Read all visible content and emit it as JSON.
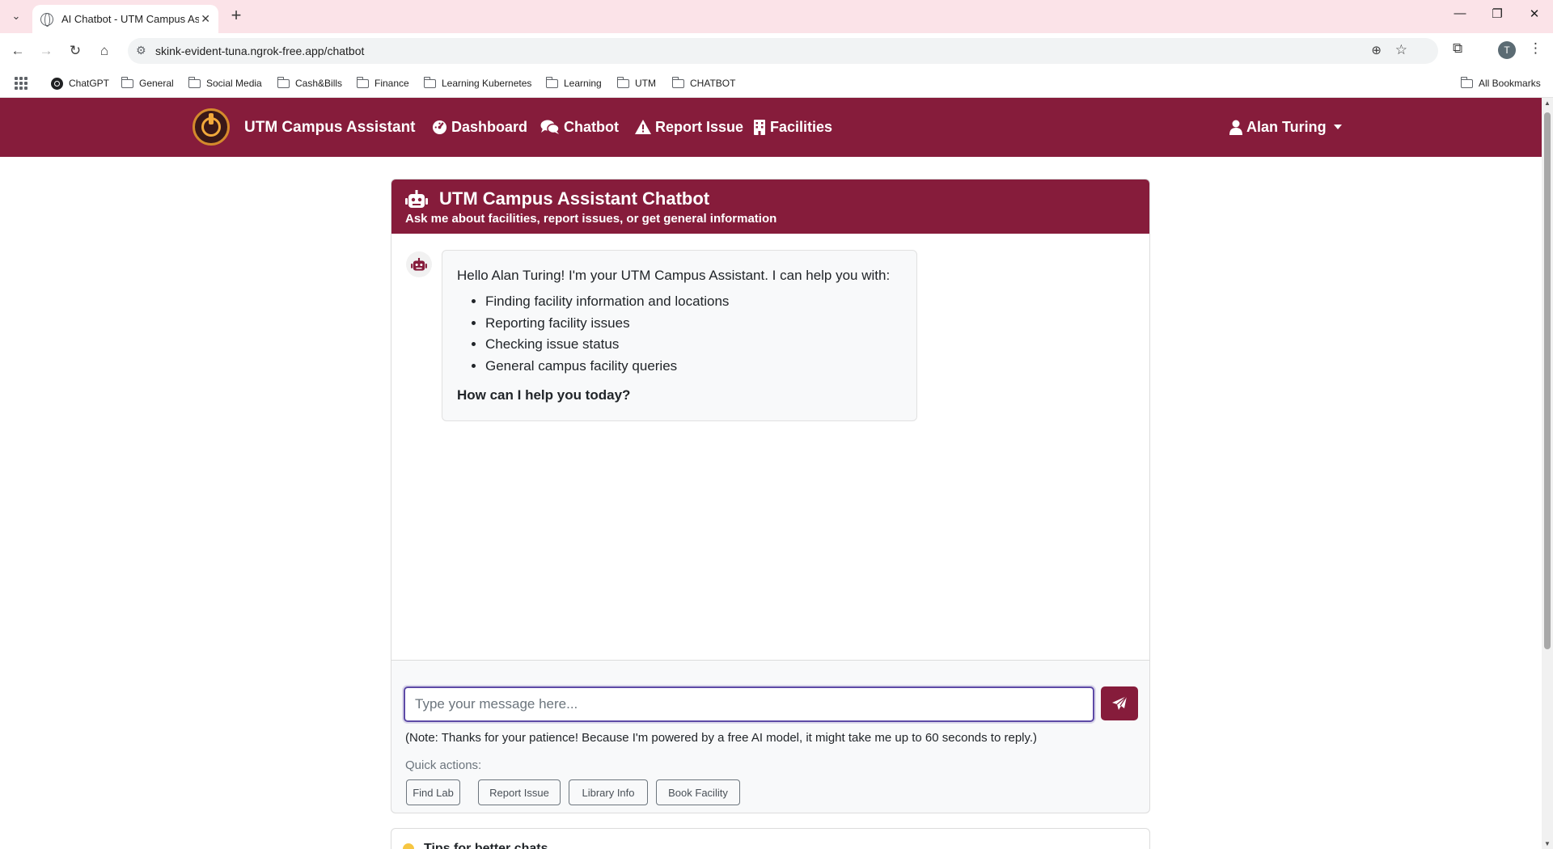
{
  "browser": {
    "tab_title": "AI Chatbot - UTM Campus Assistant",
    "url": "skink-evident-tuna.ngrok-free.app/chatbot",
    "profile_initial": "T",
    "bookmarks": [
      "ChatGPT",
      "General",
      "Social Media",
      "Cash&Bills",
      "Finance",
      "Learning Kubernetes",
      "Learning",
      "UTM",
      "CHATBOT"
    ],
    "all_bookmarks": "All Bookmarks"
  },
  "nav": {
    "brand": "UTM Campus Assistant",
    "links": [
      "Dashboard",
      "Chatbot",
      "Report Issue",
      "Facilities"
    ],
    "user": "Alan Turing"
  },
  "chat": {
    "title": "UTM Campus Assistant Chatbot",
    "subtitle": "Ask me about facilities, report issues, or get general information",
    "greeting": "Hello Alan Turing! I'm your UTM Campus Assistant. I can help you with:",
    "capabilities": [
      "Finding facility information and locations",
      "Reporting facility issues",
      "Checking issue status",
      "General campus facility queries"
    ],
    "ask": "How can I help you today?",
    "input_placeholder": "Type your message here...",
    "note": "(Note: Thanks for your patience! Because I'm powered by a free AI model, it might take me up to 60 seconds to reply.)",
    "quick_label": "Quick actions:",
    "quick_actions": [
      "Find Lab",
      "Report Issue",
      "Library Info",
      "Book Facility"
    ]
  },
  "next_section": {
    "title": "Tips for better chats"
  },
  "colors": {
    "brand": "#861c3b",
    "tabstrip": "#fbe3e8",
    "focus": "#5d4aa6"
  }
}
